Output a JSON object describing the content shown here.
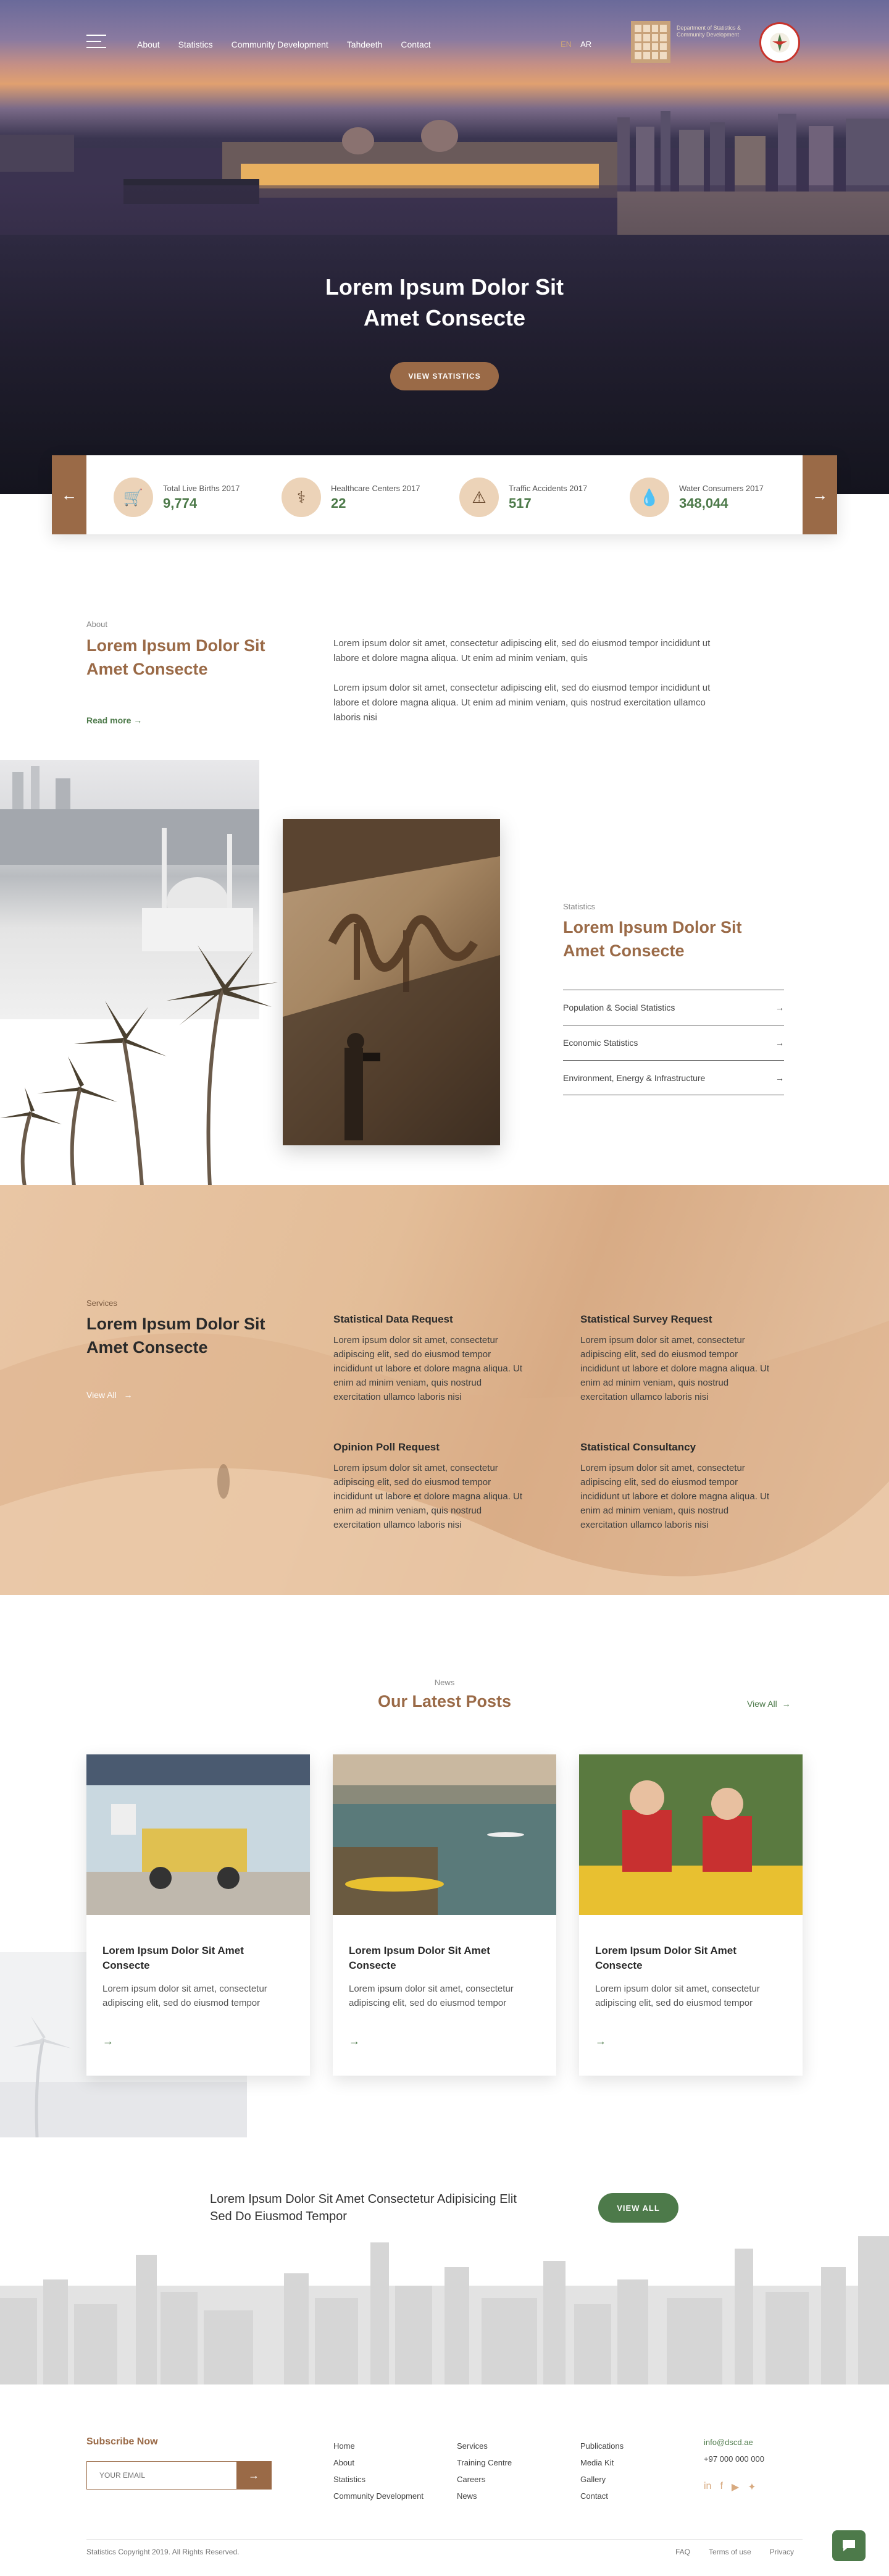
{
  "nav": {
    "links": [
      "About",
      "Statistics",
      "Community Development",
      "Tahdeeth",
      "Contact"
    ],
    "lang_en": "EN",
    "lang_ar": "AR",
    "logo_text": "Department of Statistics & Community Development"
  },
  "hero": {
    "title_line1": "Lorem Ipsum Dolor Sit",
    "title_line2": "Amet Consecte",
    "button": "VIEW STATISTICS"
  },
  "stats": [
    {
      "label": "Total Live Births 2017",
      "value": "9,774",
      "icon": "stroller-icon"
    },
    {
      "label": "Healthcare Centers 2017",
      "value": "22",
      "icon": "healthcare-icon"
    },
    {
      "label": "Traffic Accidents 2017",
      "value": "517",
      "icon": "car-crash-icon"
    },
    {
      "label": "Water Consumers 2017",
      "value": "348,044",
      "icon": "water-drop-icon"
    }
  ],
  "about": {
    "label": "About",
    "title_line1": "Lorem Ipsum Dolor Sit",
    "title_line2": "Amet Consecte",
    "para1": "Lorem ipsum dolor sit amet, consectetur adipiscing elit, sed do eiusmod tempor incididunt ut labore et dolore magna aliqua. Ut enim ad minim veniam, quis",
    "para2": "Lorem ipsum dolor sit amet, consectetur adipiscing elit, sed do eiusmod tempor incididunt ut labore et dolore magna aliqua. Ut enim ad minim veniam, quis nostrud exercitation ullamco laboris nisi",
    "read_more": "Read more"
  },
  "statistics": {
    "label": "Statistics",
    "title_line1": "Lorem Ipsum Dolor Sit",
    "title_line2": "Amet Consecte",
    "items": [
      "Population & Social Statistics",
      "Economic Statistics",
      "Environment, Energy & Infrastructure"
    ]
  },
  "services": {
    "label": "Services",
    "title_line1": "Lorem Ipsum Dolor Sit",
    "title_line2": "Amet Consecte",
    "view_all": "View All",
    "items": [
      {
        "title": "Statistical Data Request",
        "text": "Lorem ipsum dolor sit amet, consectetur adipiscing elit, sed do eiusmod tempor incididunt ut labore et dolore magna aliqua. Ut enim ad minim veniam, quis nostrud exercitation ullamco laboris nisi"
      },
      {
        "title": "Statistical Survey Request",
        "text": "Lorem ipsum dolor sit amet, consectetur adipiscing elit, sed do eiusmod tempor incididunt ut labore et dolore magna aliqua. Ut enim ad minim veniam, quis nostrud exercitation ullamco laboris nisi"
      },
      {
        "title": "Opinion Poll Request",
        "text": "Lorem ipsum dolor sit amet, consectetur adipiscing elit, sed do eiusmod tempor incididunt ut labore et dolore magna aliqua. Ut enim ad minim veniam, quis nostrud exercitation ullamco laboris nisi"
      },
      {
        "title": "Statistical Consultancy",
        "text": "Lorem ipsum dolor sit amet, consectetur adipiscing elit, sed do eiusmod tempor incididunt ut labore et dolore magna aliqua. Ut enim ad minim veniam, quis nostrud exercitation ullamco laboris nisi"
      }
    ]
  },
  "news": {
    "label": "News",
    "title": "Our Latest Posts",
    "view_all": "View All",
    "posts": [
      {
        "title": "Lorem Ipsum Dolor Sit Amet Consecte",
        "text": "Lorem ipsum dolor sit amet, consectetur adipiscing elit, sed do eiusmod tempor"
      },
      {
        "title": "Lorem Ipsum Dolor Sit Amet Consecte",
        "text": "Lorem ipsum dolor sit amet, consectetur adipiscing elit, sed do eiusmod tempor"
      },
      {
        "title": "Lorem Ipsum Dolor Sit Amet Consecte",
        "text": "Lorem ipsum dolor sit amet, consectetur adipiscing elit, sed do eiusmod tempor"
      }
    ]
  },
  "cta": {
    "text_line1": "Lorem Ipsum Dolor Sit Amet Consectetur Adipisicing Elit",
    "text_line2": "Sed Do Eiusmod Tempor",
    "button": "VIEW ALL"
  },
  "footer": {
    "subscribe_title": "Subscribe Now",
    "email_placeholder": "YOUR EMAIL",
    "col1": [
      "Home",
      "About",
      "Statistics",
      "Community Development"
    ],
    "col2": [
      "Services",
      "Training Centre",
      "Careers",
      "News"
    ],
    "col3": [
      "Publications",
      "Media Kit",
      "Gallery",
      "Contact"
    ],
    "email": "info@dscd.ae",
    "phone": "+97 000 000 000",
    "copyright": "Statistics Copyright 2019. All Rights Reserved.",
    "bottom_links": [
      "FAQ",
      "Terms of use",
      "Privacy"
    ]
  },
  "colors": {
    "brown": "#9a6a47",
    "green": "#4d7a4a",
    "sand": "#e6c3a3"
  }
}
